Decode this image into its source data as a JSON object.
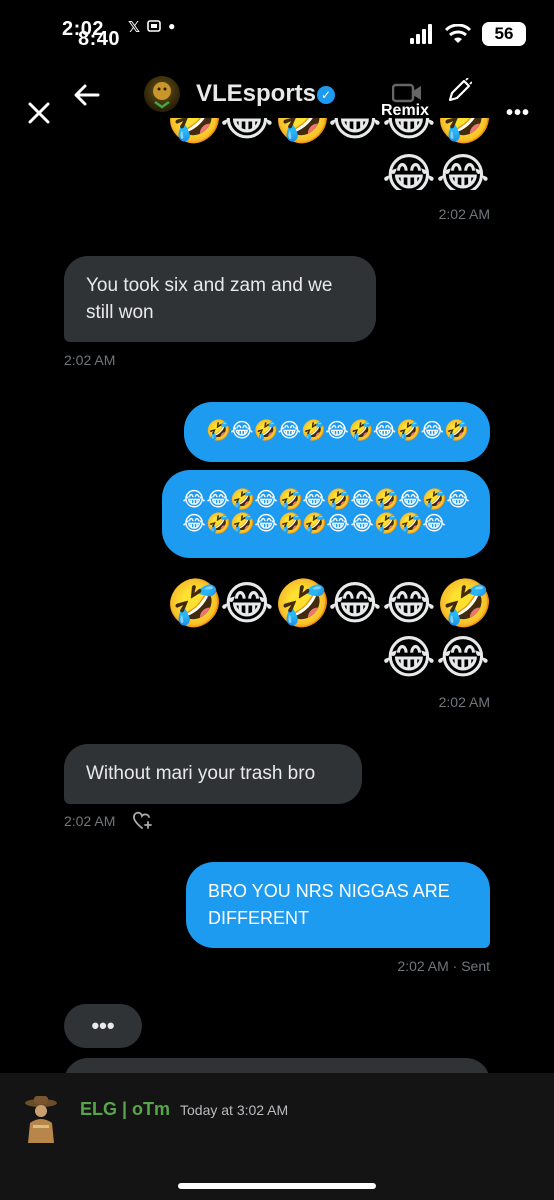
{
  "status_bar": {
    "time_behind": "2:02",
    "time_front": "8:40",
    "battery": "56",
    "left_icons": [
      "x-logo",
      "screenshot-icon",
      "dot"
    ],
    "right_icons": [
      "signal",
      "wifi",
      "battery"
    ]
  },
  "header": {
    "name": "VLEsports",
    "verified": true,
    "remix_label": "Remix",
    "more_label": "•••"
  },
  "colors": {
    "incoming_bubble": "#2f3336",
    "outgoing_bubble": "#1d9bf0",
    "timestamp": "#71767b",
    "verified": "#1d9bf0",
    "discord_name": "#57a64a"
  },
  "messages": [
    {
      "id": "m1",
      "direction": "outgoing",
      "type": "emoji-cluster",
      "emoji": [
        "😂",
        "😂"
      ],
      "time": "2:02 AM"
    },
    {
      "id": "m2",
      "direction": "incoming",
      "type": "text",
      "text_lines": [
        "You took six and zam and we",
        "still won"
      ],
      "time": "2:02 AM"
    },
    {
      "id": "m3",
      "direction": "outgoing",
      "type": "emoji-bubble",
      "emoji": [
        "🤣",
        "😂",
        "🤣",
        "😂",
        "🤣",
        "😂",
        "🤣",
        "😂",
        "🤣",
        "😂",
        "🤣"
      ]
    },
    {
      "id": "m4",
      "direction": "outgoing",
      "type": "emoji-bubble",
      "lines": [
        [
          "😂",
          "😂",
          "🤣",
          "😂",
          "🤣",
          "😂",
          "🤣",
          "😂",
          "🤣",
          "😂",
          "🤣",
          "😂"
        ],
        [
          "😂",
          "🤣",
          "🤣",
          "😂",
          "🤣",
          "🤣",
          "😂",
          "😂",
          "🤣",
          "🤣",
          "😂"
        ]
      ]
    },
    {
      "id": "m5",
      "direction": "outgoing",
      "type": "emoji-cluster",
      "lines": [
        [
          "🤣",
          "😂",
          "🤣",
          "😂",
          "😂",
          "🤣"
        ],
        [
          "😂",
          "😂"
        ]
      ],
      "time": "2:02 AM"
    },
    {
      "id": "m6",
      "direction": "incoming",
      "type": "text",
      "text_lines": [
        "Without mari your trash bro"
      ],
      "time": "2:02 AM"
    },
    {
      "id": "m7",
      "direction": "outgoing",
      "type": "text",
      "text_lines": [
        "BRO YOU NRS NIGGAS ARE",
        "DIFFERENT"
      ],
      "time": "2:02 AM · Sent"
    },
    {
      "id": "m8",
      "direction": "incoming",
      "type": "typing",
      "text": "•••"
    }
  ],
  "discord_overlay": {
    "username": "ELG | oTm",
    "timestamp": "Today at 3:02 AM"
  }
}
